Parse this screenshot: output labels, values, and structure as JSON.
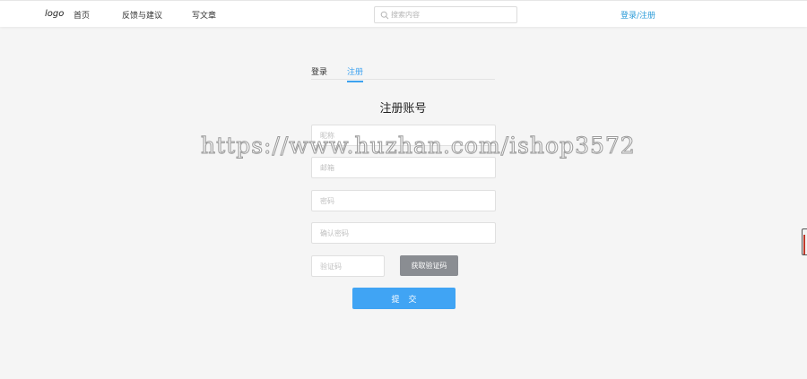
{
  "header": {
    "logo": "logo",
    "nav": {
      "home": "首页",
      "feedback": "反馈与建议",
      "write": "写文章"
    },
    "search": {
      "placeholder": "搜索内容",
      "icon": "search-icon"
    },
    "login_register": "登录/注册"
  },
  "tabs": {
    "login": "登录",
    "register": "注册"
  },
  "form": {
    "title": "注册账号",
    "nickname_placeholder": "昵称",
    "email_placeholder": "邮箱",
    "password_placeholder": "密码",
    "confirm_placeholder": "确认密码",
    "code_placeholder": "验证码",
    "get_code_label": "获取验证码",
    "submit_label": "提交"
  },
  "watermark": "https://www.huzhan.com/ishop3572",
  "colors": {
    "accent": "#40a4f4",
    "link": "#2b9bd8",
    "code_button": "#8a8d92",
    "background": "#f5f5f5"
  }
}
